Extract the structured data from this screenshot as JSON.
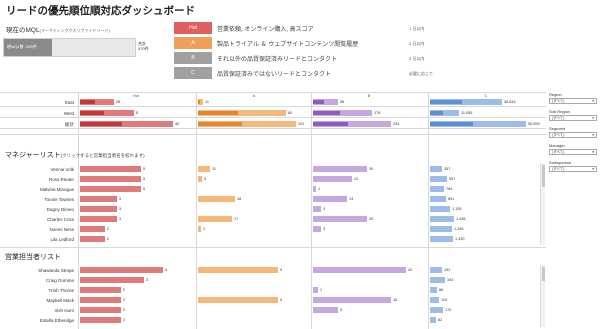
{
  "header": {
    "title": "リードの優先順位順対応ダッシュボード"
  },
  "mql": {
    "label": "現在のMQL",
    "sublabel": "(マーケティングクオリファイドリード)",
    "bar_text": "総MQL数: 209件",
    "value_line1": "合計",
    "value_line2": "570件",
    "fill_fraction": 0.37
  },
  "priority": [
    {
      "letter": "Hot",
      "text": "営業依頼, オンライン購入, 高スコア",
      "rate": "1 日以内",
      "color": "#e06060"
    },
    {
      "letter": "A",
      "text": "製品トライアル ＆ ウェブサイトコンテンツ閲覧履歴",
      "rate": "3 日以内",
      "color": "#f0a058"
    },
    {
      "letter": "B",
      "text": "それ以外の品質保証済みリードとコンタクト",
      "rate": "5 日以内",
      "color": "#a0a0a0"
    },
    {
      "letter": "C",
      "text": "品質保証済みではないリードとコンタクト",
      "rate": "必要に応じて",
      "color": "#a0a0a0"
    }
  ],
  "columns": [
    {
      "label": "Hot",
      "color": "#e07b7b",
      "dark": "#c0393b"
    },
    {
      "label": "A",
      "color": "#f5b878",
      "dark": "#e8842c"
    },
    {
      "label": "B",
      "color": "#c5a8e0",
      "dark": "#8f5cc4"
    },
    {
      "label": "C",
      "color": "#9dbde8",
      "dark": "#5b8fd6"
    }
  ],
  "region_table": {
    "rows": [
      {
        "label": "East",
        "values": [
          "28",
          "11",
          "56",
          "38,844"
        ],
        "fills": [
          0.35,
          0.05,
          0.25,
          0.73
        ]
      },
      {
        "label": "West",
        "values": [
          "5",
          "80",
          "176",
          "11,055"
        ],
        "fills": [
          0.55,
          0.9,
          0.6,
          0.3
        ]
      },
      {
        "label": "総計",
        "values": [
          "40",
          "101",
          "234",
          "50,999"
        ],
        "fills": [
          0.95,
          1.0,
          0.8,
          0.98
        ]
      }
    ]
  },
  "manager_section": {
    "title": "マネジャーリスト",
    "subtitle": "(クリックすると営業担当者名を絞れます)",
    "rows": [
      {
        "label": "Vennie Volk",
        "values": [
          "5",
          "11",
          "30",
          "357"
        ],
        "fills": [
          0.62,
          0.12,
          0.55,
          0.12
        ]
      },
      {
        "label": "Ross Reuter",
        "values": [
          "5",
          "3",
          "12",
          "957"
        ],
        "fills": [
          0.62,
          0.04,
          0.4,
          0.17
        ]
      },
      {
        "label": "Malvina Minogue",
        "values": [
          "5",
          "",
          "1",
          "764"
        ],
        "fills": [
          0.62,
          0.0,
          0.03,
          0.14
        ]
      },
      {
        "label": "Tonnie Townes",
        "values": [
          "3",
          "18",
          "13",
          "891"
        ],
        "fills": [
          0.38,
          0.38,
          0.35,
          0.16
        ]
      },
      {
        "label": "Dagny Dimeo",
        "values": [
          "3",
          "",
          "3",
          "1,155"
        ],
        "fills": [
          0.38,
          0.0,
          0.08,
          0.2
        ]
      },
      {
        "label": "Charles Criss",
        "values": [
          "3",
          "17",
          "20",
          "1,436"
        ],
        "fills": [
          0.38,
          0.35,
          0.55,
          0.24
        ]
      },
      {
        "label": "Noemi Ness",
        "values": [
          "2",
          "1",
          "3",
          "1,246"
        ],
        "fills": [
          0.25,
          0.03,
          0.08,
          0.22
        ]
      },
      {
        "label": "Lila Ledford",
        "values": [
          "2",
          "",
          "",
          "1,330"
        ],
        "fills": [
          0.25,
          0.0,
          0.0,
          0.23
        ]
      }
    ]
  },
  "rep_section": {
    "title": "営業担当者リスト",
    "rows": [
      {
        "label": "Shawanda Strope",
        "values": [
          "4",
          "9",
          "20",
          "152"
        ],
        "fills": [
          0.85,
          0.82,
          0.95,
          0.12
        ]
      },
      {
        "label": "Craig Gomme",
        "values": [
          "3",
          "",
          "",
          "192"
        ],
        "fills": [
          0.65,
          0.0,
          0.0,
          0.15
        ]
      },
      {
        "label": "Trinh Thorne",
        "values": [
          "2",
          "",
          "1",
          "86"
        ],
        "fills": [
          0.42,
          0.0,
          0.05,
          0.07
        ]
      },
      {
        "label": "Maybell Mack",
        "values": [
          "2",
          "9",
          "16",
          "119"
        ],
        "fills": [
          0.42,
          0.82,
          0.8,
          0.09
        ]
      },
      {
        "label": "Irish Isom",
        "values": [
          "2",
          "",
          "5",
          "170"
        ],
        "fills": [
          0.42,
          0.0,
          0.25,
          0.13
        ]
      },
      {
        "label": "Estella Etheridge",
        "values": [
          "2",
          "",
          "",
          "82"
        ],
        "fills": [
          0.42,
          0.0,
          0.0,
          0.06
        ]
      }
    ]
  },
  "filters": [
    {
      "label": "Region",
      "value": "(すべて)"
    },
    {
      "label": "Sub Region",
      "value": "(すべて)"
    },
    {
      "label": "Segment",
      "value": "(すべて)"
    },
    {
      "label": "Manager",
      "value": "(すべて)"
    },
    {
      "label": "Salesperson",
      "value": "(すべて)"
    }
  ]
}
